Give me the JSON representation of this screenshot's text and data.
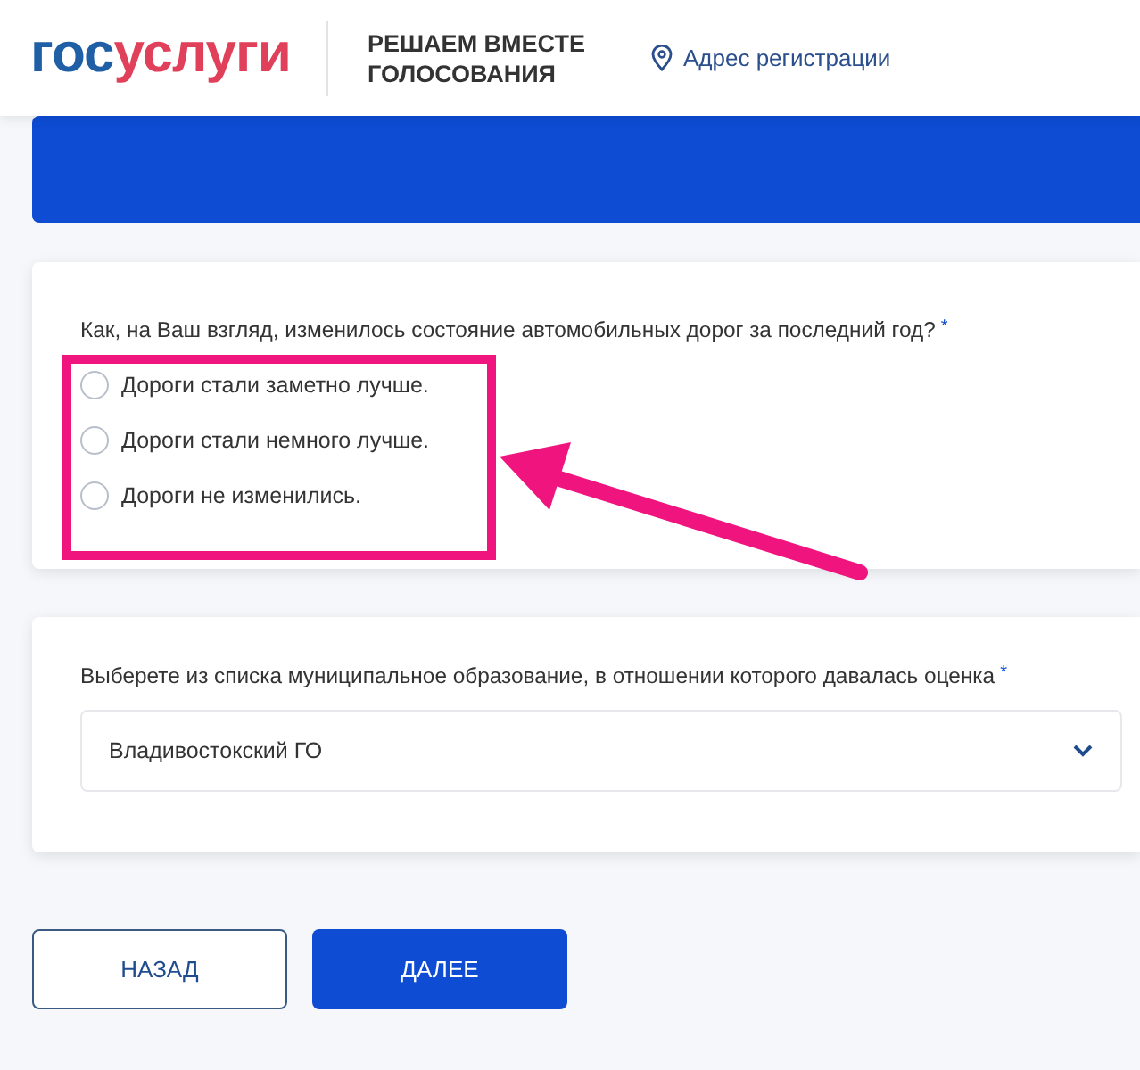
{
  "header": {
    "logo": {
      "part_1": "гос",
      "part_2": "услуги"
    },
    "section_title": "РЕШАЕМ ВМЕСТЕ ГОЛОСОВАНИЯ",
    "location_link": "Адрес регистрации"
  },
  "question": {
    "text": "Как, на Ваш взгляд, изменилось состояние автомобильных дорог за последний год?",
    "required_mark": "*",
    "options": [
      {
        "label": "Дороги стали заметно лучше.",
        "selected": false
      },
      {
        "label": "Дороги стали немного лучше.",
        "selected": false
      },
      {
        "label": "Дороги не изменились.",
        "selected": false
      }
    ]
  },
  "municipality": {
    "label": "Выберете из списка муниципальное образование, в отношении которого давалась оценка",
    "required_mark": "*",
    "value": "Владивостокский ГО"
  },
  "buttons": [
    {
      "label": "НАЗАД",
      "kind": "secondary"
    },
    {
      "label": "ДАЛЕЕ",
      "kind": "primary"
    }
  ],
  "annotation": {
    "kind": "frame_and_arrow"
  }
}
